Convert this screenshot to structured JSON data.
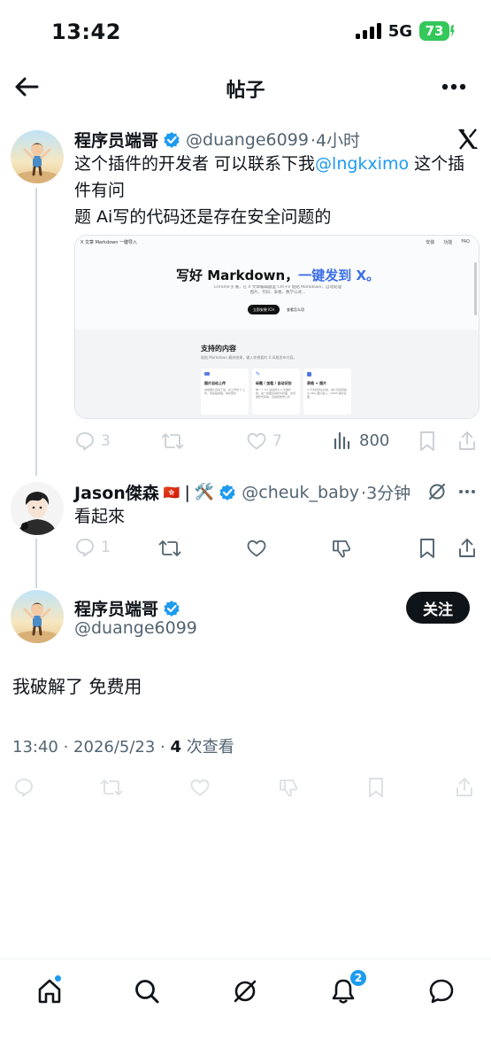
{
  "status_bar": {
    "time": "13:42",
    "network": "5G",
    "battery": "73"
  },
  "header": {
    "title": "帖子",
    "back_icon": "arrow-left-icon",
    "more_icon": "more-horizontal-icon"
  },
  "post1": {
    "author_name": "程序员端哥",
    "handle": "@duange6099",
    "time_ago": "·4小时",
    "text_before_mention": "这个插件的开发者 可以联系下我",
    "mention": "@lngkximo",
    "text_after_mention": " 这个插件有问",
    "text_line3": "题 Ai写的代码还是存在安全问题的",
    "card": {
      "nav_brand": "X 文章 Markdown 一键导入",
      "nav_links": [
        "安装",
        "功能",
        "FAQ"
      ],
      "headline_part1": "写好 Markdown，",
      "headline_part2": "一键发到 X。",
      "subtitle": "Chrome 扩展，在 X 文章编辑器里 Ctrl+V 粘贴 Markdown，自动处理图片、代码、表格、数学公式...",
      "cta_primary": "立即安装 ICH",
      "cta_secondary": "查看怎么用",
      "section_title": "支持的内容",
      "section_desc": "粘贴 Markdown 最终结果，输入你想要的 X 风格发布内容。",
      "features": [
        {
          "title": "图片自动上传",
          "desc": "本地图片自动下载，并上传到 X 上传，非粘贴成图，体积更优"
        },
        {
          "title": "标题 / 加粗 / 自动识别",
          "desc": "单一个 H1 自动转为 X 文章标题，第一张图自动作为封面，支持嵌套代码块、表格和数学公式"
        },
        {
          "title": "表格 + 图片",
          "desc": "X 不支持原生表格，用户自动转换为 PNG 图片嵌入；MDPP 等标签图"
        }
      ]
    },
    "stats": {
      "replies": "3",
      "retweets": "",
      "likes": "7",
      "views": "800"
    }
  },
  "reply": {
    "author_name": "Jason傑森",
    "flag": "🇭🇰",
    "separator": "|",
    "tools_emoji": "🛠️",
    "handle": "@cheuk_baby",
    "time_ago": "·3分钟",
    "text": "看起來",
    "stats": {
      "replies": "1"
    }
  },
  "main_post": {
    "author_name": "程序员端哥",
    "handle": "@duange6099",
    "follow_label": "关注",
    "text": "我破解了 免费用",
    "meta_time": "13:40 · 2026/5/23 · ",
    "views_count": "4",
    "views_label": " 次查看"
  },
  "bottom_nav": {
    "items": [
      "home-icon",
      "search-icon",
      "grok-icon",
      "notifications-icon",
      "messages-icon"
    ],
    "notification_badge": "2"
  },
  "colors": {
    "accent": "#1d9bf0",
    "text": "#0f1419",
    "muted": "#536471",
    "battery": "#34c759"
  }
}
